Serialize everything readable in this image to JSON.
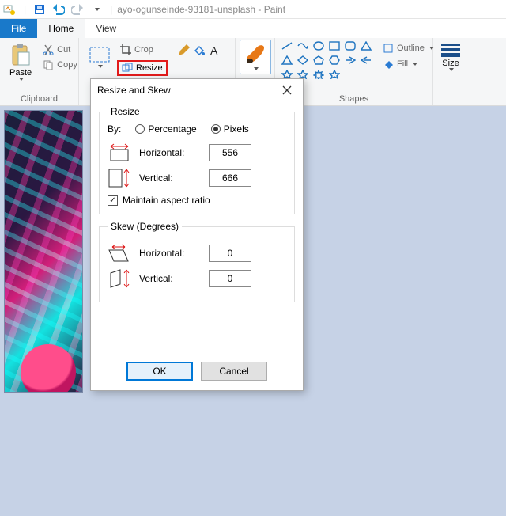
{
  "title_filename": "ayo-ogunseinde-93181-unsplash - Paint",
  "tabs": {
    "file": "File",
    "home": "Home",
    "view": "View"
  },
  "ribbon": {
    "clipboard": {
      "paste": "Paste",
      "cut": "Cut",
      "copy": "Copy",
      "group": "Clipboard"
    },
    "image": {
      "crop": "Crop",
      "resize": "Resize"
    },
    "shapes": {
      "group": "Shapes",
      "outline": "Outline",
      "fill": "Fill"
    },
    "size": {
      "label": "Size"
    }
  },
  "dialog": {
    "title": "Resize and Skew",
    "resize": {
      "legend": "Resize",
      "by": "By:",
      "percentage": "Percentage",
      "pixels": "Pixels",
      "horizontal": "Horizontal:",
      "vertical": "Vertical:",
      "h_value": "556",
      "v_value": "666",
      "maintain": "Maintain aspect ratio"
    },
    "skew": {
      "legend": "Skew (Degrees)",
      "horizontal": "Horizontal:",
      "vertical": "Vertical:",
      "h_value": "0",
      "v_value": "0"
    },
    "ok": "OK",
    "cancel": "Cancel"
  }
}
